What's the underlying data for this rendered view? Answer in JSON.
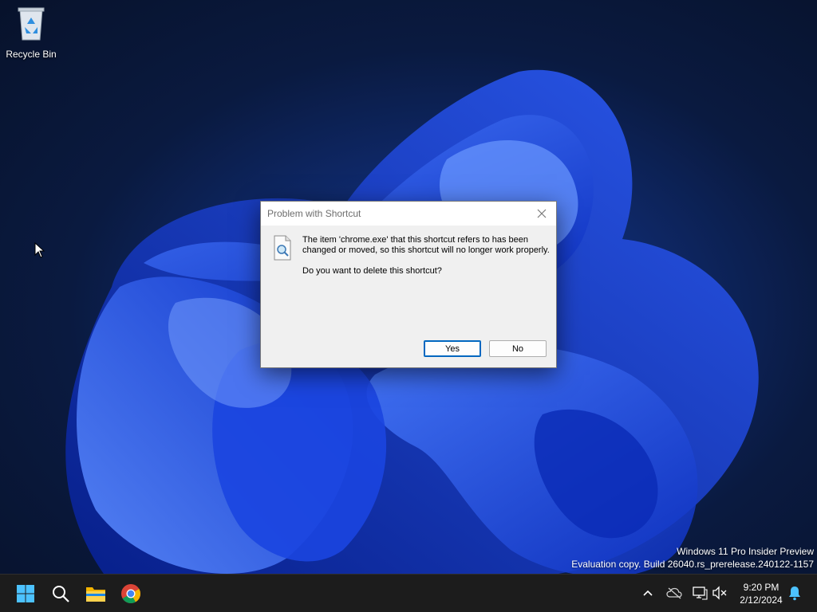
{
  "desktop": {
    "icons": [
      {
        "label": "Recycle Bin",
        "icon": "recycle-bin-icon"
      }
    ],
    "watermark": {
      "line1": "Windows 11 Pro Insider Preview",
      "line2": "Evaluation copy. Build 26040.rs_prerelease.240122-1157"
    }
  },
  "dialog": {
    "title": "Problem with Shortcut",
    "icon": "shortcut-search-icon",
    "message": "The item 'chrome.exe' that this shortcut refers to has been changed or moved, so this shortcut will no longer work properly.",
    "question": "Do you want to delete this shortcut?",
    "buttons": {
      "yes": "Yes",
      "no": "No"
    },
    "close_icon": "close-icon"
  },
  "taskbar": {
    "apps": [
      {
        "name": "Start",
        "icon": "windows-start-icon"
      },
      {
        "name": "Search",
        "icon": "search-icon"
      },
      {
        "name": "File Explorer",
        "icon": "folder-icon"
      },
      {
        "name": "Google Chrome",
        "icon": "chrome-icon"
      }
    ],
    "tray": {
      "icons": [
        "chevron-up-icon",
        "cloud-offline-icon",
        "network-icon",
        "speaker-muted-icon",
        "notification-bell-icon"
      ],
      "time": "9:20 PM",
      "date": "2/12/2024"
    }
  },
  "colors": {
    "accent": "#0067c0",
    "taskbar": "#1c1c1c",
    "dialog_bg": "#f0f0f0"
  }
}
